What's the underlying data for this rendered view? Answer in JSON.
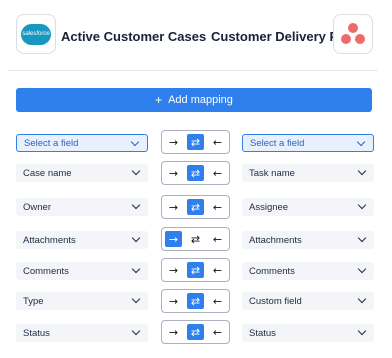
{
  "header": {
    "left_app": {
      "title": "Active Customer Cases",
      "logo_text": "salesforce",
      "icon": "salesforce-cloud-icon",
      "color": "#1798c1"
    },
    "right_app": {
      "title": "Customer Delivery Plan",
      "icon": "asana-icon",
      "color": "#f06a6a"
    }
  },
  "add_mapping": {
    "label": "Add mapping",
    "icon": "plus-icon",
    "color": "#2f80ed"
  },
  "arrows": {
    "right": "→",
    "both": "⇄",
    "left": "←"
  },
  "rows": [
    {
      "left": "Select a field",
      "right": "Select a field",
      "direction": "both",
      "placeholder": true
    },
    {
      "left": "Case name",
      "right": "Task name",
      "direction": "both"
    },
    {
      "left": "Owner",
      "right": "Assignee",
      "direction": "both"
    },
    {
      "left": "Attachments",
      "right": "Attachments",
      "direction": "right"
    },
    {
      "left": "Comments",
      "right": "Comments",
      "direction": "both"
    },
    {
      "left": "Type",
      "right": "Custom field",
      "direction": "both"
    },
    {
      "left": "Status",
      "right": "Status",
      "direction": "both"
    }
  ]
}
